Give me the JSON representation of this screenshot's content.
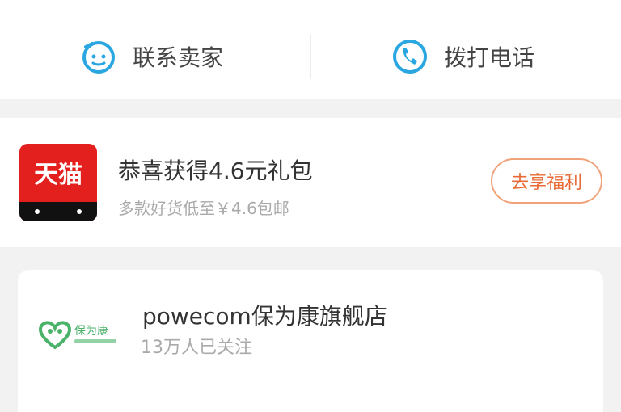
{
  "contact": {
    "seller_label": "联系卖家",
    "call_label": "拨打电话",
    "seller_icon": "chat-face-icon",
    "call_icon": "phone-icon",
    "accent_color": "#2aa7e0"
  },
  "gift": {
    "logo_text": "天猫",
    "title": "恭喜获得4.6元礼包",
    "subtitle": "多款好货低至￥4.6包邮",
    "button_label": "去享福利",
    "button_color": "#e86a35",
    "logo_color": "#e4201f"
  },
  "shop": {
    "logo_text": "保为康",
    "name": "powecom保为康旗舰店",
    "followers": "13万人已关注",
    "logo_color": "#4bb26a"
  }
}
